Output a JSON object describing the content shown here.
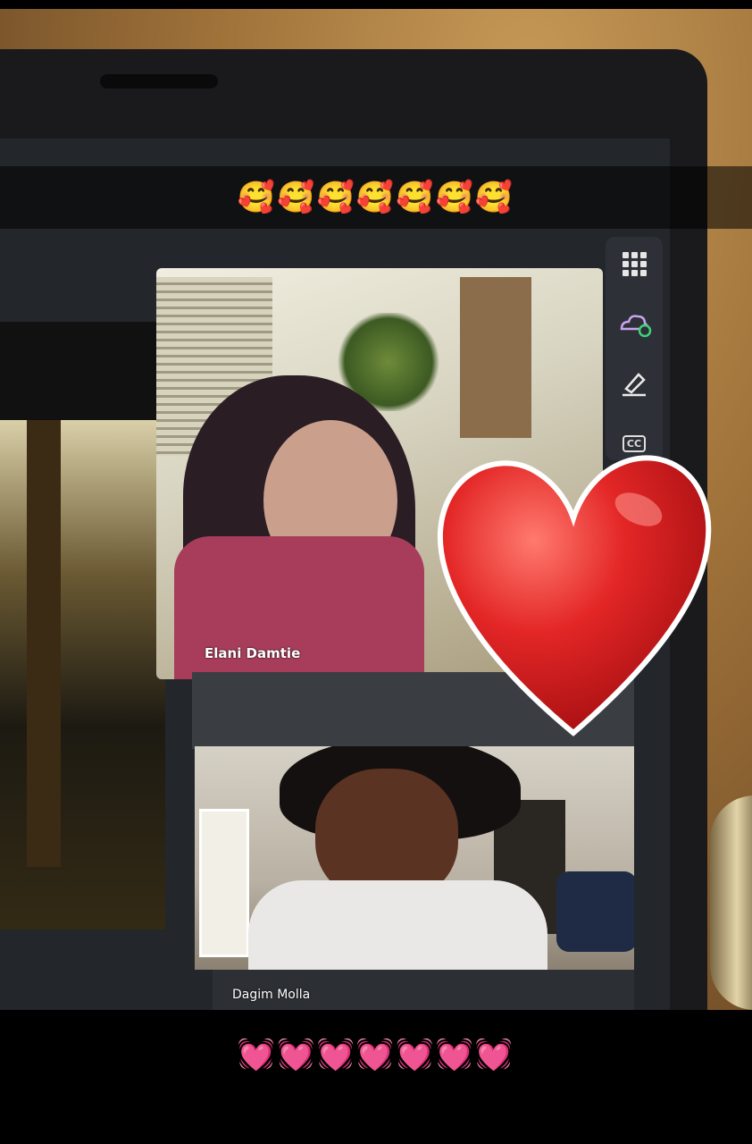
{
  "snap_caption_top": "🥰🥰🥰🥰🥰🥰🥰",
  "snap_caption_bottom": "💓💓💓💓💓💓💓",
  "participants": [
    {
      "name": "Elani Damtie"
    },
    {
      "name": "Dagim Molla"
    }
  ],
  "toolbar": {
    "icons": [
      "grid-icon",
      "cloud-effects-icon",
      "highlighter-icon",
      "closed-captions-icon"
    ],
    "cc_label": "CC"
  },
  "sticker": "heart",
  "colors": {
    "heart": "#e32626",
    "screen_bg": "#23262b",
    "wall": "#b8894a"
  }
}
